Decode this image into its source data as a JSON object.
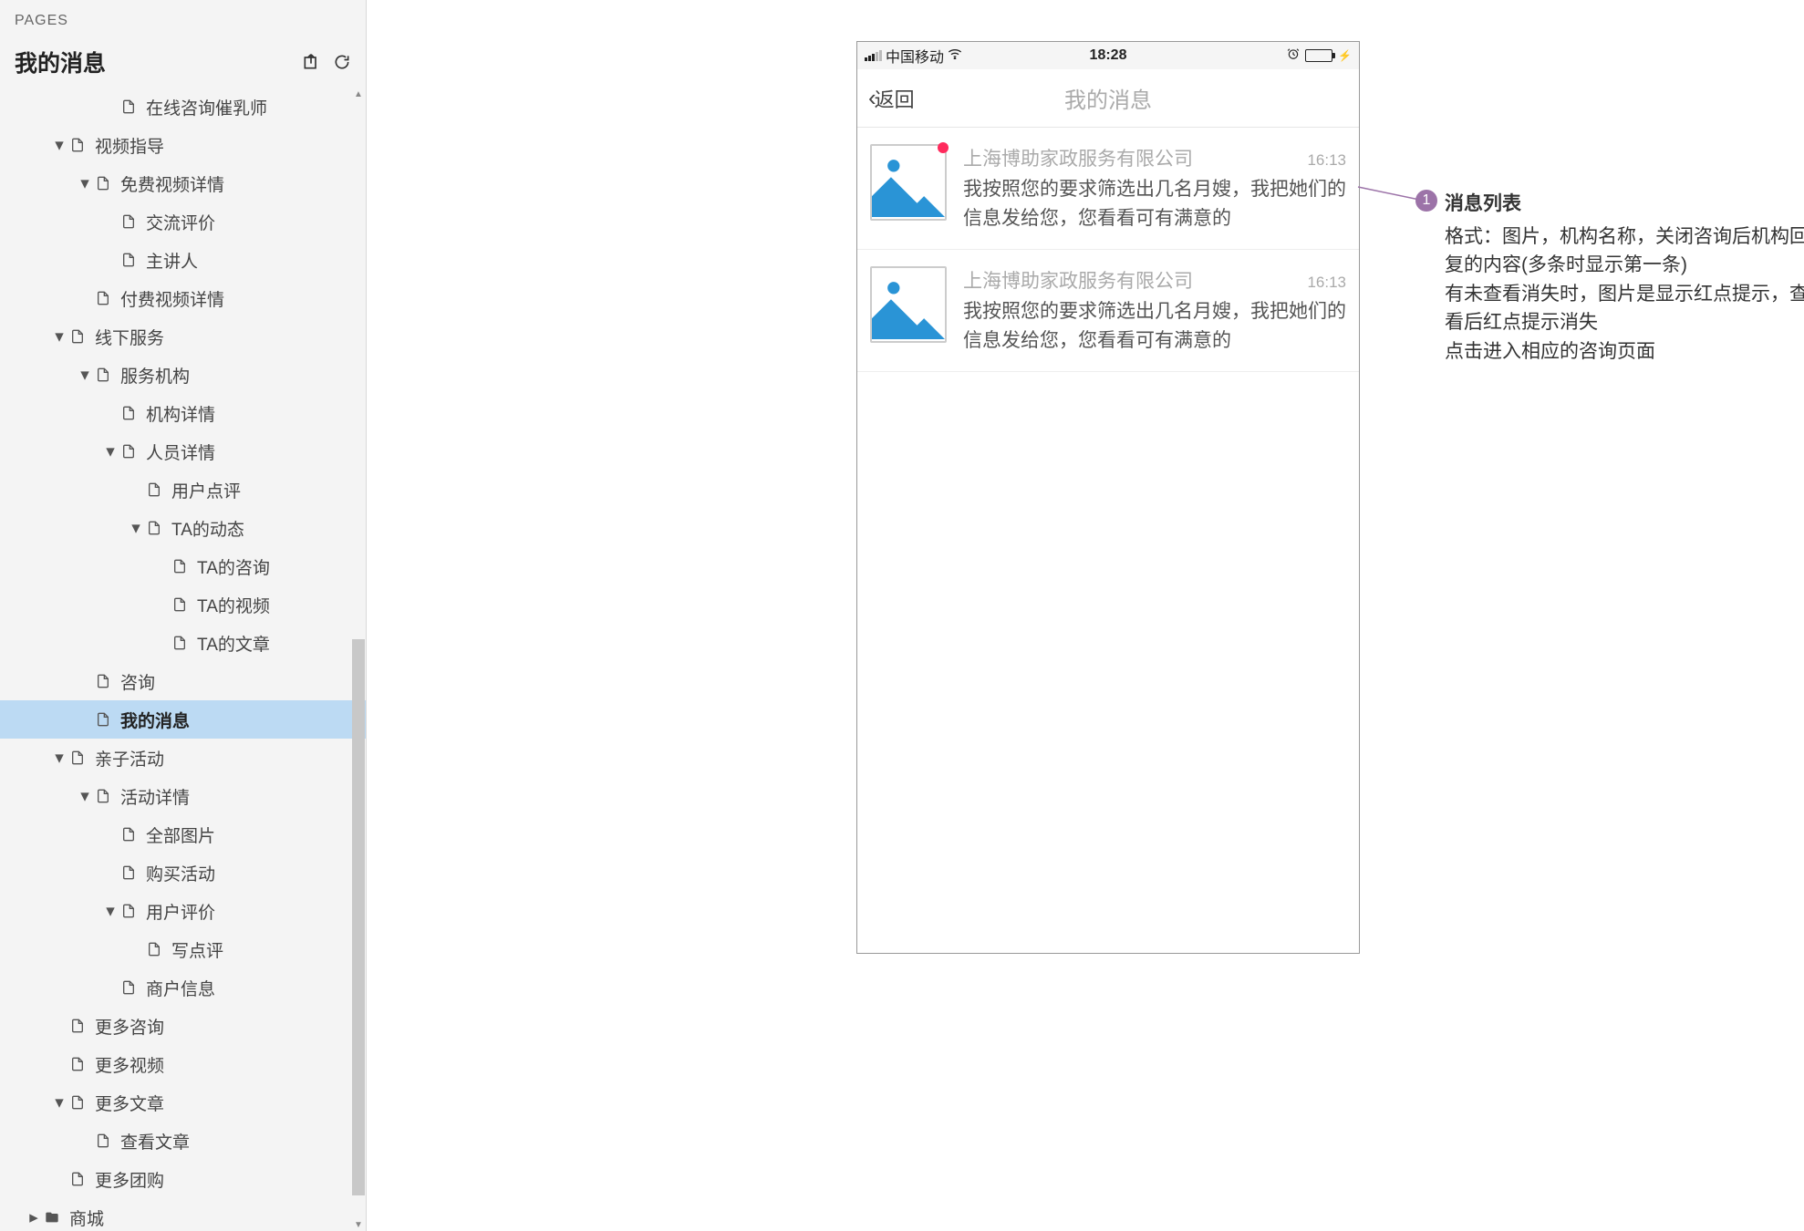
{
  "sidebar": {
    "header": "PAGES",
    "title": "我的消息",
    "items": [
      {
        "indent": 4,
        "caret": "",
        "type": "file",
        "label": "在线咨询催乳师"
      },
      {
        "indent": 2,
        "caret": "down",
        "type": "file",
        "label": "视频指导"
      },
      {
        "indent": 3,
        "caret": "down",
        "type": "file",
        "label": "免费视频详情"
      },
      {
        "indent": 4,
        "caret": "",
        "type": "file",
        "label": "交流评价"
      },
      {
        "indent": 4,
        "caret": "",
        "type": "file",
        "label": "主讲人"
      },
      {
        "indent": 3,
        "caret": "",
        "type": "file",
        "label": "付费视频详情"
      },
      {
        "indent": 2,
        "caret": "down",
        "type": "file",
        "label": "线下服务"
      },
      {
        "indent": 3,
        "caret": "down",
        "type": "file",
        "label": "服务机构"
      },
      {
        "indent": 4,
        "caret": "",
        "type": "file",
        "label": "机构详情"
      },
      {
        "indent": 4,
        "caret": "down",
        "type": "file",
        "label": "人员详情"
      },
      {
        "indent": 5,
        "caret": "",
        "type": "file",
        "label": "用户点评"
      },
      {
        "indent": 5,
        "caret": "down",
        "type": "file",
        "label": "TA的动态"
      },
      {
        "indent": 6,
        "caret": "",
        "type": "file",
        "label": "TA的咨询"
      },
      {
        "indent": 6,
        "caret": "",
        "type": "file",
        "label": "TA的视频"
      },
      {
        "indent": 6,
        "caret": "",
        "type": "file",
        "label": "TA的文章"
      },
      {
        "indent": 3,
        "caret": "",
        "type": "file",
        "label": "咨询"
      },
      {
        "indent": 3,
        "caret": "",
        "type": "file",
        "label": "我的消息",
        "selected": true
      },
      {
        "indent": 2,
        "caret": "down",
        "type": "file",
        "label": "亲子活动"
      },
      {
        "indent": 3,
        "caret": "down",
        "type": "file",
        "label": "活动详情"
      },
      {
        "indent": 4,
        "caret": "",
        "type": "file",
        "label": "全部图片"
      },
      {
        "indent": 4,
        "caret": "",
        "type": "file",
        "label": "购买活动"
      },
      {
        "indent": 4,
        "caret": "down",
        "type": "file",
        "label": "用户评价"
      },
      {
        "indent": 5,
        "caret": "",
        "type": "file",
        "label": "写点评"
      },
      {
        "indent": 4,
        "caret": "",
        "type": "file",
        "label": "商户信息"
      },
      {
        "indent": 2,
        "caret": "",
        "type": "file",
        "label": "更多咨询"
      },
      {
        "indent": 2,
        "caret": "",
        "type": "file",
        "label": "更多视频"
      },
      {
        "indent": 2,
        "caret": "down",
        "type": "file",
        "label": "更多文章"
      },
      {
        "indent": 3,
        "caret": "",
        "type": "file",
        "label": "查看文章"
      },
      {
        "indent": 2,
        "caret": "",
        "type": "file",
        "label": "更多团购"
      },
      {
        "indent": 1,
        "caret": "right",
        "type": "folder",
        "label": "商城"
      }
    ]
  },
  "phone": {
    "status": {
      "carrier": "中国移动",
      "time": "18:28"
    },
    "nav": {
      "back": "返回",
      "title": "我的消息"
    },
    "messages": [
      {
        "unread": true,
        "name": "上海博助家政服务有限公司",
        "time": "16:13",
        "text": "我按照您的要求筛选出几名月嫂，我把她们的信息发给您，您看看可有满意的"
      },
      {
        "unread": false,
        "name": "上海博助家政服务有限公司",
        "time": "16:13",
        "text": "我按照您的要求筛选出几名月嫂，我把她们的信息发给您，您看看可有满意的"
      }
    ]
  },
  "annotation": {
    "num": "1",
    "title": "消息列表",
    "body": "格式：图片，机构名称，关闭咨询后机构回复的内容(多条时显示第一条)\n有未查看消失时，图片是显示红点提示，查看后红点提示消失\n点击进入相应的咨询页面"
  }
}
